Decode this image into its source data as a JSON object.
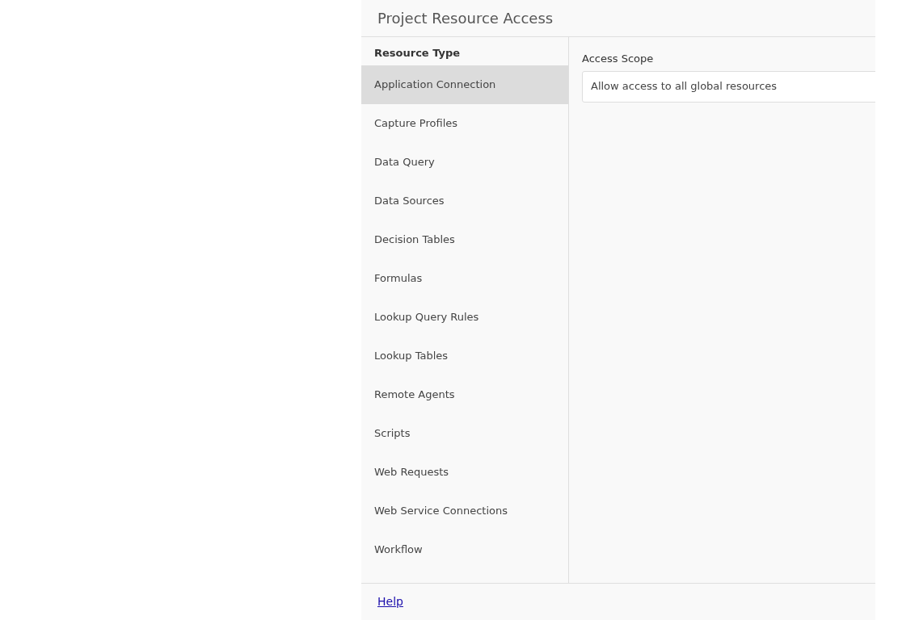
{
  "dialog": {
    "title": "Project Resource Access"
  },
  "sidebar": {
    "heading": "Resource Type",
    "items": [
      {
        "label": "Application Connection",
        "selected": true
      },
      {
        "label": "Capture Profiles",
        "selected": false
      },
      {
        "label": "Data Query",
        "selected": false
      },
      {
        "label": "Data Sources",
        "selected": false
      },
      {
        "label": "Decision Tables",
        "selected": false
      },
      {
        "label": "Formulas",
        "selected": false
      },
      {
        "label": "Lookup Query Rules",
        "selected": false
      },
      {
        "label": "Lookup Tables",
        "selected": false
      },
      {
        "label": "Remote Agents",
        "selected": false
      },
      {
        "label": "Scripts",
        "selected": false
      },
      {
        "label": "Web Requests",
        "selected": false
      },
      {
        "label": "Web Service Connections",
        "selected": false
      },
      {
        "label": "Workflow",
        "selected": false
      }
    ]
  },
  "access_scope": {
    "label": "Access Scope",
    "value": "Allow access to all global resources"
  },
  "footer": {
    "link": "Help"
  }
}
